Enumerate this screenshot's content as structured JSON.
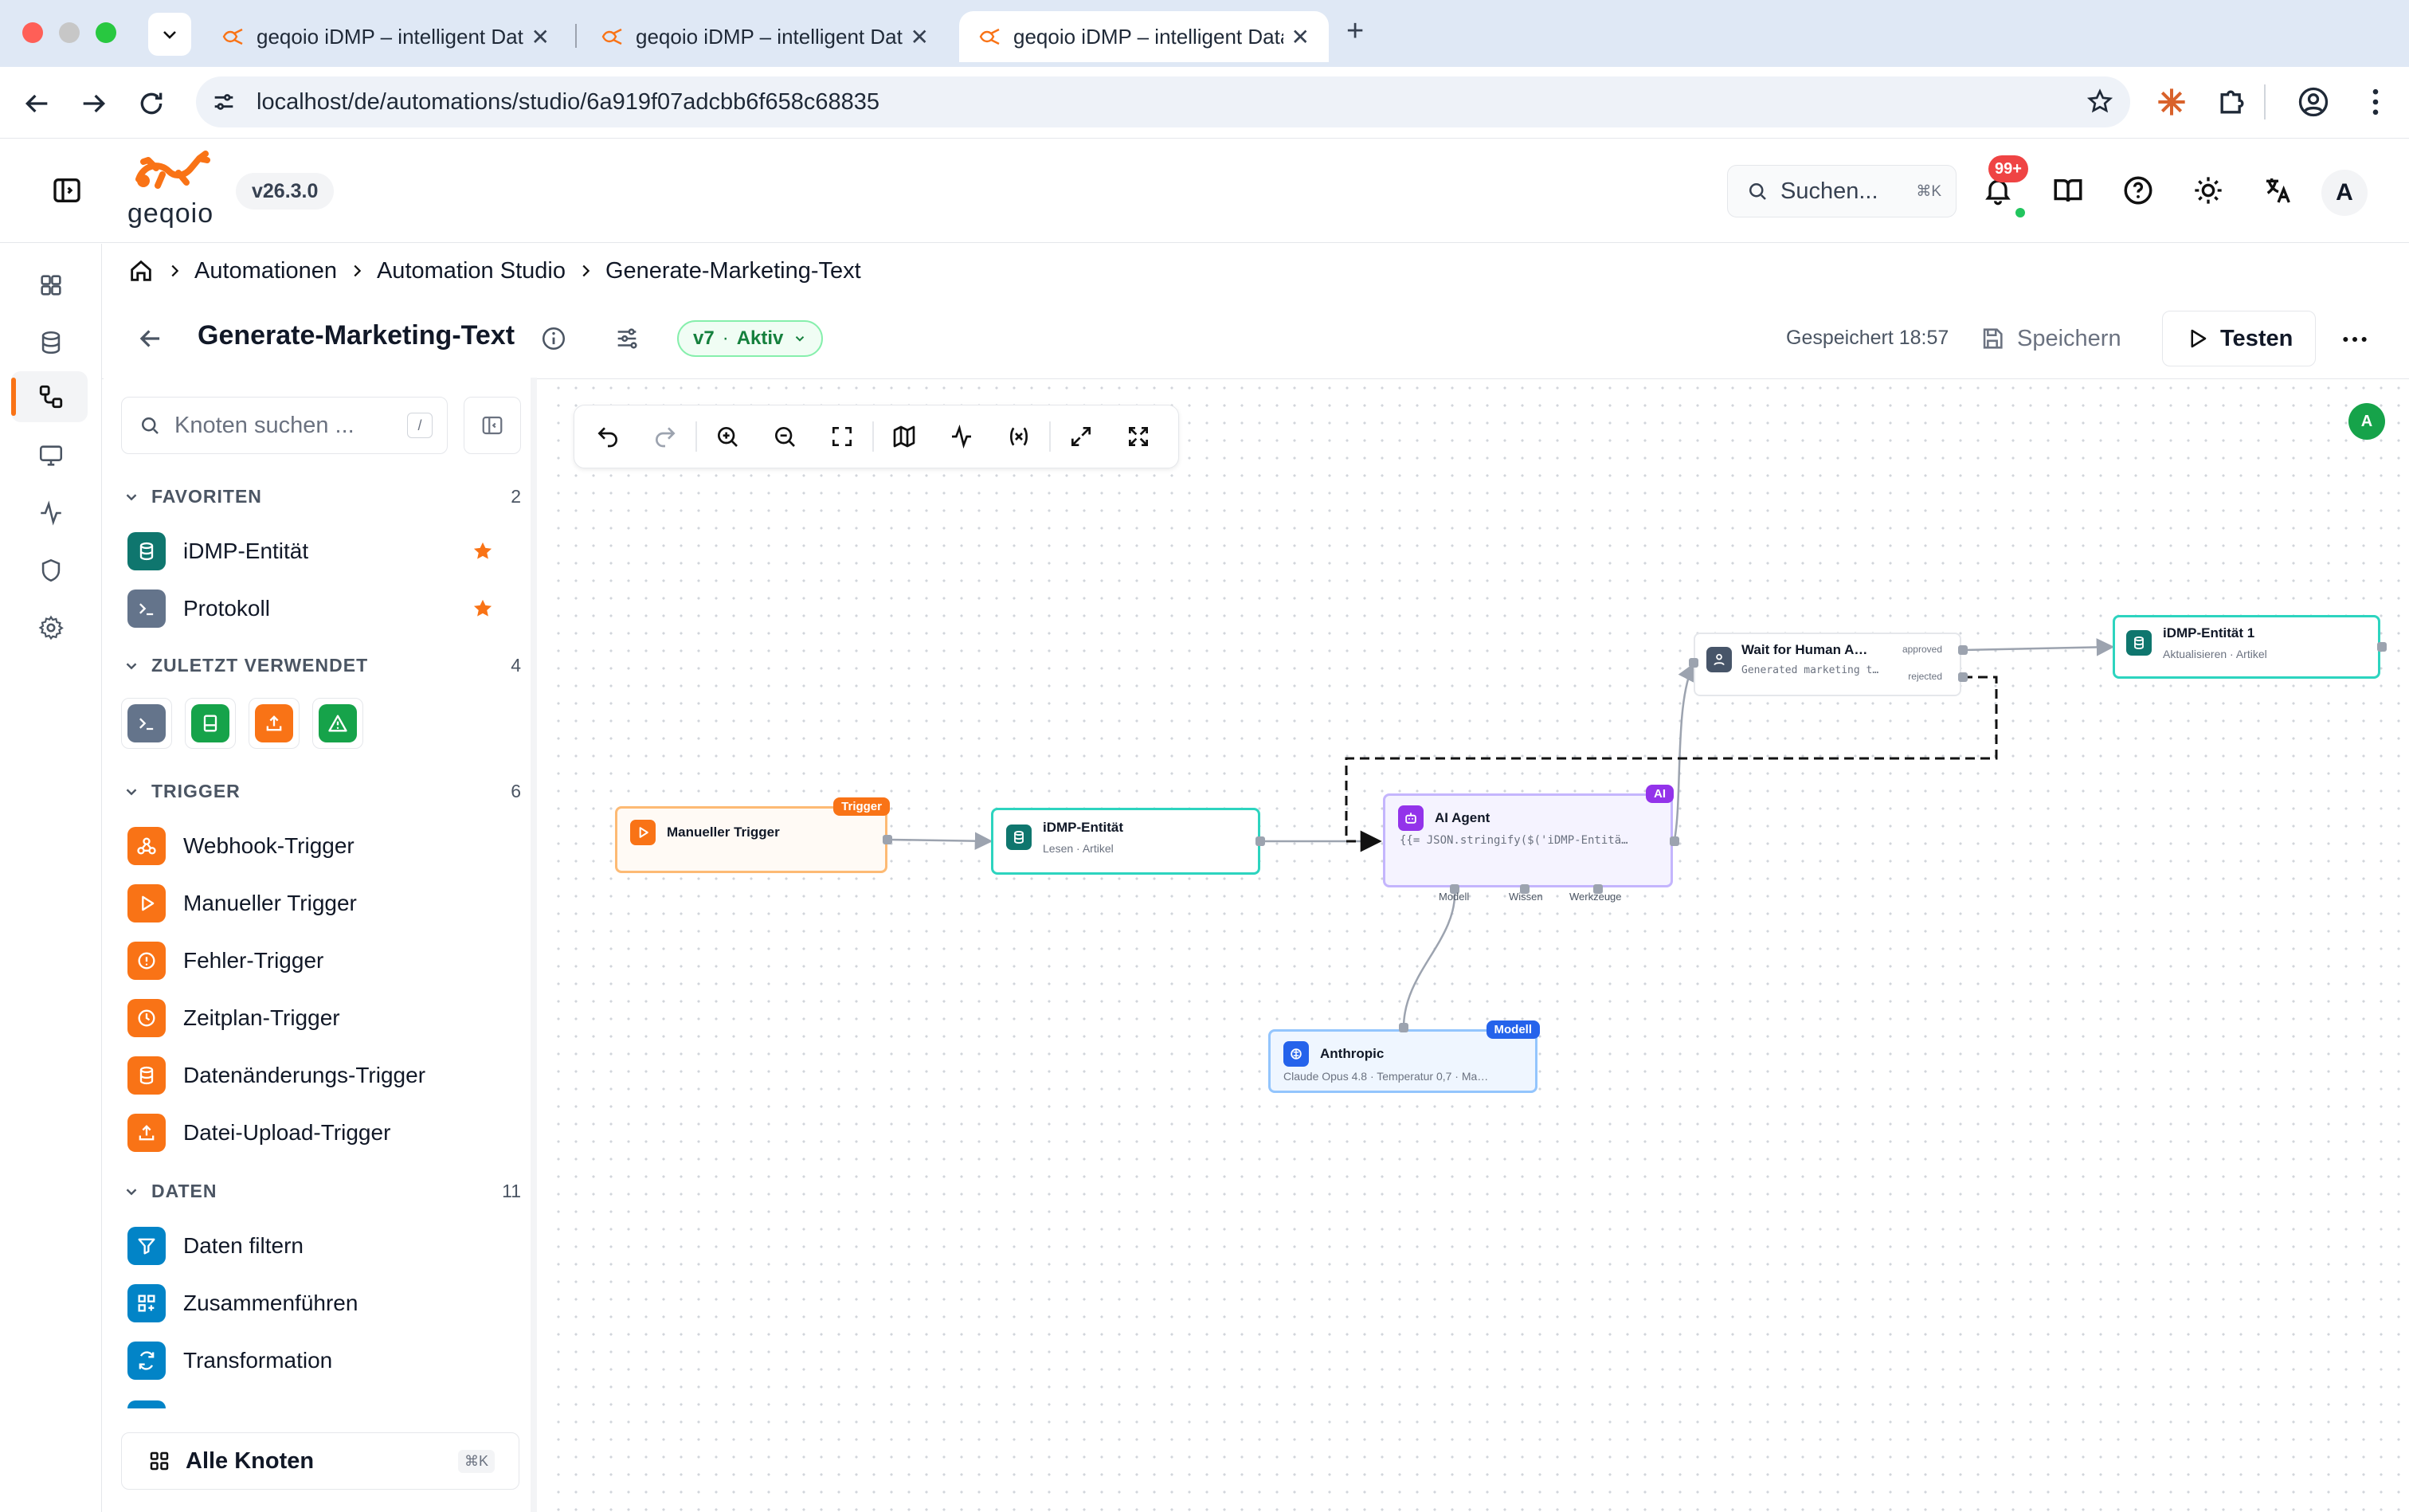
{
  "browser": {
    "tabs": [
      {
        "title": "geqoio iDMP – intelligent Data"
      },
      {
        "title": "geqoio iDMP – intelligent Data"
      },
      {
        "title": "geqoio iDMP – intelligent Data"
      }
    ],
    "url": "localhost/de/automations/studio/6a919f07adcbb6f658c68835"
  },
  "header": {
    "logo_text": "geqoio",
    "version": "v26.3.0",
    "search_placeholder": "Suchen...",
    "search_shortcut": "⌘K",
    "notif_badge": "99+",
    "avatar": "A"
  },
  "breadcrumb": [
    "Automationen",
    "Automation Studio",
    "Generate-Marketing-Text"
  ],
  "titlebar": {
    "title": "Generate-Marketing-Text",
    "version": "v7",
    "status": "Aktiv",
    "saved": "Gespeichert 18:57",
    "save": "Speichern",
    "test": "Testen"
  },
  "panel": {
    "search_placeholder": "Knoten suchen ...",
    "search_shortcut": "/",
    "favorites": {
      "title": "FAVORITEN",
      "count": "2",
      "items": [
        "iDMP-Entität",
        "Protokoll"
      ]
    },
    "recent": {
      "title": "ZULETZT VERWENDET",
      "count": "4"
    },
    "trigger": {
      "title": "TRIGGER",
      "count": "6",
      "items": [
        "Webhook-Trigger",
        "Manueller Trigger",
        "Fehler-Trigger",
        "Zeitplan-Trigger",
        "Datenänderungs-Trigger",
        "Datei-Upload-Trigger"
      ]
    },
    "data": {
      "title": "DATEN",
      "count": "11",
      "items": [
        "Daten filtern",
        "Zusammenführen",
        "Transformation"
      ]
    },
    "all_nodes": "Alle Knoten",
    "all_shortcut": "⌘K"
  },
  "canvas": {
    "user_avatar": "A",
    "nodes": {
      "manual": {
        "title": "Manueller Trigger",
        "tag": "Trigger"
      },
      "entity": {
        "title": "iDMP-Entität",
        "sub": "Lesen · Artikel"
      },
      "agent": {
        "title": "AI Agent",
        "sub": "{{= JSON.stringify($('iDMP-Entitä…",
        "tag": "AI",
        "ports": [
          "Modell",
          "Wissen",
          "Werkzeuge"
        ]
      },
      "wait": {
        "title": "Wait for Human A…",
        "sub": "Generated marketing t…",
        "approved": "approved",
        "rejected": "rejected"
      },
      "entity1": {
        "title": "iDMP-Entität 1",
        "sub": "Aktualisieren · Artikel"
      },
      "anthropic": {
        "title": "Anthropic",
        "sub": "Claude Opus 4.8 · Temperatur 0,7 · Ma…",
        "tag": "Modell"
      }
    }
  },
  "colors": {
    "orange": "#f97316",
    "teal": "#0f766e",
    "purple": "#7c3aed",
    "blue": "#2563eb",
    "green": "#16a34a"
  }
}
